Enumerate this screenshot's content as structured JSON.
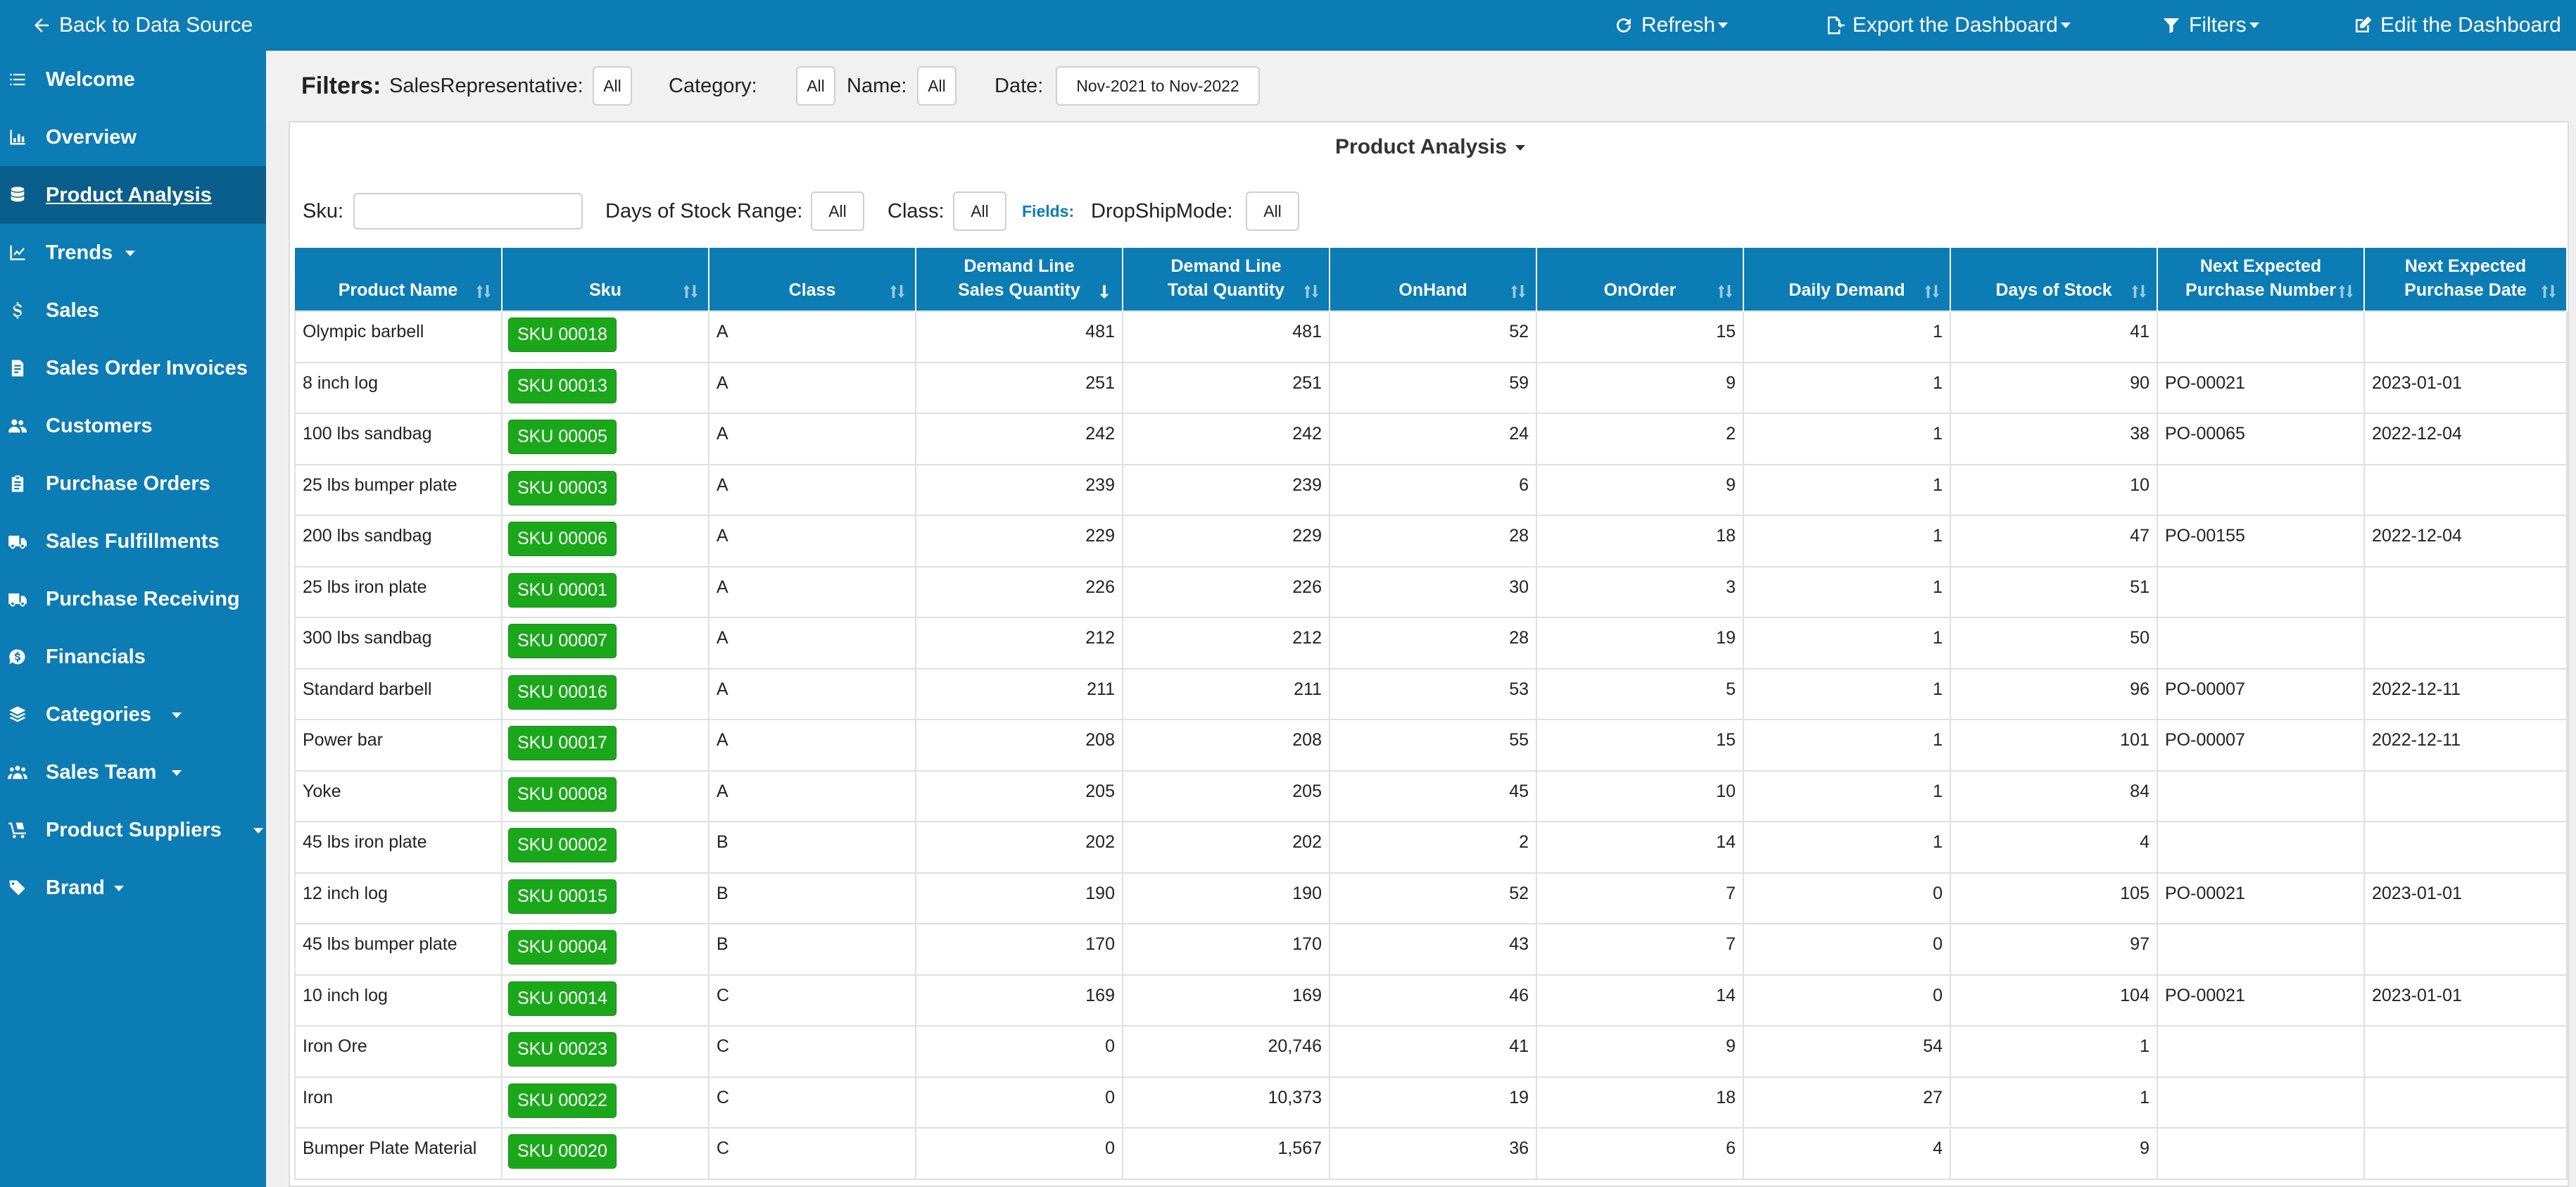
{
  "topbar": {
    "back_label": "Back to Data Source",
    "refresh_label": "Refresh",
    "export_label": "Export the Dashboard",
    "filters_label": "Filters",
    "edit_label": "Edit the Dashboard"
  },
  "sidebar": {
    "items": [
      {
        "label": "Welcome",
        "icon": "list-icon"
      },
      {
        "label": "Overview",
        "icon": "chart-icon"
      },
      {
        "label": "Product Analysis",
        "icon": "database-icon",
        "active": true
      },
      {
        "label": "Trends",
        "icon": "trend-line-icon",
        "dropdown": true
      },
      {
        "label": "Sales",
        "icon": "dollar-icon"
      },
      {
        "label": "Sales Order Invoices",
        "icon": "invoice-icon"
      },
      {
        "label": "Customers",
        "icon": "users-icon"
      },
      {
        "label": "Purchase Orders",
        "icon": "clipboard-icon"
      },
      {
        "label": "Sales Fulfillments",
        "icon": "truck-icon"
      },
      {
        "label": "Purchase Receiving",
        "icon": "truck-icon"
      },
      {
        "label": "Financials",
        "icon": "money-icon"
      },
      {
        "label": "Categories",
        "icon": "layers-icon",
        "dropdown": true
      },
      {
        "label": "Sales Team",
        "icon": "team-icon",
        "dropdown": true
      },
      {
        "label": "Product Suppliers",
        "icon": "dolly-icon",
        "dropdown": true
      },
      {
        "label": "Brand",
        "icon": "tags-icon",
        "dropdown": true
      }
    ]
  },
  "filters": {
    "title": "Filters:",
    "sales_rep_label": "SalesRepresentative:",
    "sales_rep_value": "All",
    "category_label": "Category:",
    "category_value": "All",
    "name_label": "Name:",
    "name_value": "All",
    "date_label": "Date:",
    "date_value": "Nov-2021 to Nov-2022"
  },
  "panel": {
    "title": "Product Analysis",
    "sku_label": "Sku:",
    "sku_value": "",
    "days_label": "Days of Stock Range:",
    "days_value": "All",
    "class_label": "Class:",
    "class_value": "All",
    "fields_label": "Fields:",
    "dropship_label": "DropShipMode:",
    "dropship_value": "All"
  },
  "table": {
    "columns": [
      [
        "Product Name"
      ],
      [
        "Sku"
      ],
      [
        "Class"
      ],
      [
        "Demand Line",
        "Sales Quantity"
      ],
      [
        "Demand Line",
        "Total Quantity"
      ],
      [
        "OnHand"
      ],
      [
        "OnOrder"
      ],
      [
        "Daily Demand"
      ],
      [
        "Days of Stock"
      ],
      [
        "Next Expected",
        "Purchase Number"
      ],
      [
        "Next Expected",
        "Purchase Date"
      ]
    ],
    "rows": [
      [
        "Olympic barbell",
        "SKU 00018",
        "A",
        "481",
        "481",
        "52",
        "15",
        "1",
        "41",
        "",
        ""
      ],
      [
        "8 inch log",
        "SKU 00013",
        "A",
        "251",
        "251",
        "59",
        "9",
        "1",
        "90",
        "PO-00021",
        "2023-01-01"
      ],
      [
        "100 lbs sandbag",
        "SKU 00005",
        "A",
        "242",
        "242",
        "24",
        "2",
        "1",
        "38",
        "PO-00065",
        "2022-12-04"
      ],
      [
        "25 lbs bumper plate",
        "SKU 00003",
        "A",
        "239",
        "239",
        "6",
        "9",
        "1",
        "10",
        "",
        ""
      ],
      [
        "200 lbs sandbag",
        "SKU 00006",
        "A",
        "229",
        "229",
        "28",
        "18",
        "1",
        "47",
        "PO-00155",
        "2022-12-04"
      ],
      [
        "25 lbs iron plate",
        "SKU 00001",
        "A",
        "226",
        "226",
        "30",
        "3",
        "1",
        "51",
        "",
        ""
      ],
      [
        "300 lbs sandbag",
        "SKU 00007",
        "A",
        "212",
        "212",
        "28",
        "19",
        "1",
        "50",
        "",
        ""
      ],
      [
        "Standard barbell",
        "SKU 00016",
        "A",
        "211",
        "211",
        "53",
        "5",
        "1",
        "96",
        "PO-00007",
        "2022-12-11"
      ],
      [
        "Power bar",
        "SKU 00017",
        "A",
        "208",
        "208",
        "55",
        "15",
        "1",
        "101",
        "PO-00007",
        "2022-12-11"
      ],
      [
        "Yoke",
        "SKU 00008",
        "A",
        "205",
        "205",
        "45",
        "10",
        "1",
        "84",
        "",
        ""
      ],
      [
        "45 lbs iron plate",
        "SKU 00002",
        "B",
        "202",
        "202",
        "2",
        "14",
        "1",
        "4",
        "",
        ""
      ],
      [
        "12 inch log",
        "SKU 00015",
        "B",
        "190",
        "190",
        "52",
        "7",
        "0",
        "105",
        "PO-00021",
        "2023-01-01"
      ],
      [
        "45 lbs bumper plate",
        "SKU 00004",
        "B",
        "170",
        "170",
        "43",
        "7",
        "0",
        "97",
        "",
        ""
      ],
      [
        "10 inch log",
        "SKU 00014",
        "C",
        "169",
        "169",
        "46",
        "14",
        "0",
        "104",
        "PO-00021",
        "2023-01-01"
      ],
      [
        "Iron Ore",
        "SKU 00023",
        "C",
        "0",
        "20,746",
        "41",
        "9",
        "54",
        "1",
        "",
        ""
      ],
      [
        "Iron",
        "SKU 00022",
        "C",
        "0",
        "10,373",
        "19",
        "18",
        "27",
        "1",
        "",
        ""
      ],
      [
        "Bumper Plate Material",
        "SKU 00020",
        "C",
        "0",
        "1,567",
        "36",
        "6",
        "4",
        "9",
        "",
        ""
      ]
    ]
  },
  "colors": {
    "primary": "#0c7cb5",
    "active_nav": "#0a5e8b",
    "sku_badge": "#1aa81a"
  }
}
